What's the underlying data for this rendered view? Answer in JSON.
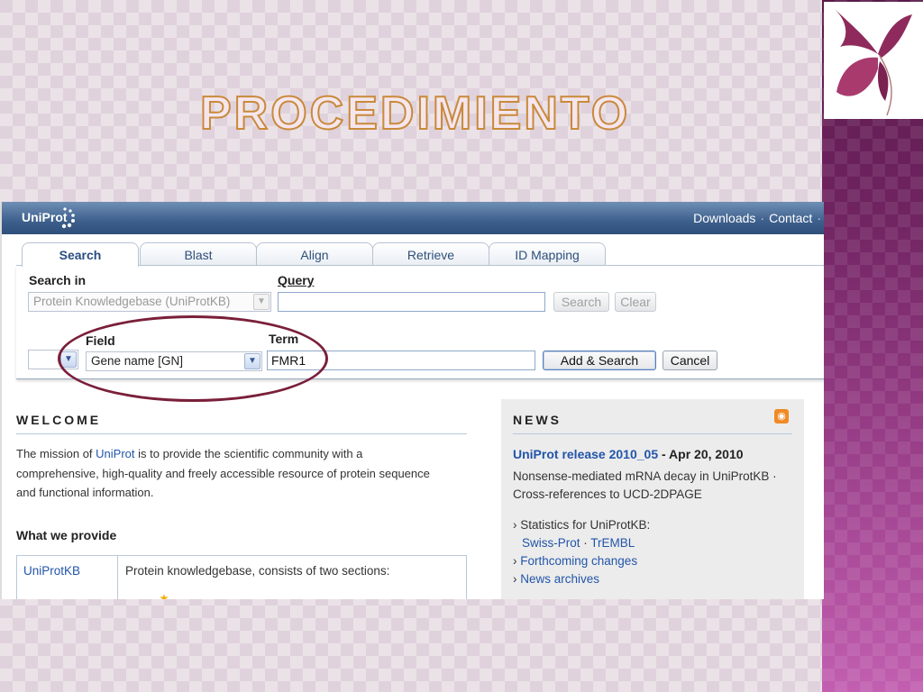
{
  "slide": {
    "title": "Procedimiento"
  },
  "colors": {
    "accent_purple": "#6f2360",
    "uniprot_blue": "#2f4f7a",
    "link_blue": "#2255aa",
    "ellipse": "#7a1f3a",
    "title_outline": "#c98a3a"
  },
  "uniprot": {
    "brand": "UniProt",
    "top_links": [
      "Downloads",
      "Contact"
    ],
    "top_link_separator": "·",
    "tabs": [
      {
        "label": "Search",
        "active": true
      },
      {
        "label": "Blast",
        "active": false
      },
      {
        "label": "Align",
        "active": false
      },
      {
        "label": "Retrieve",
        "active": false
      },
      {
        "label": "ID Mapping",
        "active": false
      }
    ],
    "search": {
      "search_in_label": "Search in",
      "search_in_value": "Protein Knowledgebase (UniProtKB)",
      "query_label": "Query",
      "query_value": "",
      "search_button": "Search",
      "clear_button": "Clear",
      "field_label": "Field",
      "field_value": "Gene name [GN]",
      "term_label": "Term",
      "term_value": "FMR1",
      "operator_value": "",
      "add_search_button": "Add & Search",
      "cancel_button": "Cancel"
    },
    "welcome": {
      "heading": "WELCOME",
      "text_before_link": "The mission of ",
      "link": "UniProt",
      "text_after_link_1": " is to provide the scientific community with a",
      "line2": "comprehensive, high-quality and freely accessible resource of protein sequence",
      "line3": "and functional information.",
      "what_we_provide": "What we provide",
      "table": {
        "row1_name": "UniProtKB",
        "row1_desc": "Protein knowledgebase, consists of two sections:"
      }
    },
    "news": {
      "heading": "NEWS",
      "release_link": "UniProt release 2010_05",
      "release_date": " - Apr 20, 2010",
      "release_line1": "Nonsense-mediated mRNA decay in UniProtKB ·",
      "release_line2": "Cross-references to UCD-2DPAGE",
      "stats_label": "› Statistics for UniProtKB:",
      "swissprot": "Swiss-Prot",
      "stats_sep": " · ",
      "trembl": "TrEMBL",
      "forthcoming": "Forthcoming changes",
      "archives": "News archives",
      "bullet": "› "
    }
  }
}
